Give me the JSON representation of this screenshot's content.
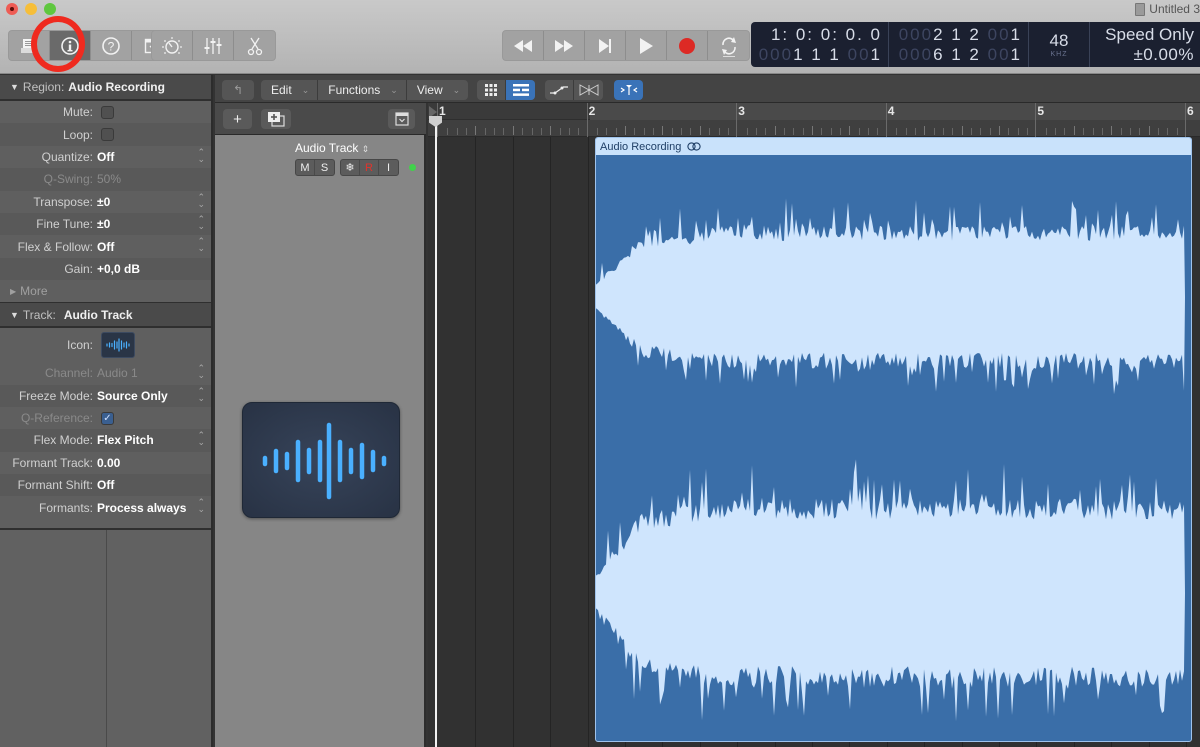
{
  "window": {
    "title": "Untitled 3",
    "traffic_lights": [
      "close",
      "minimize",
      "zoom"
    ]
  },
  "control_bar": {
    "view_buttons": [
      {
        "name": "library-button",
        "icon": "library-icon",
        "glyph": "▤"
      },
      {
        "name": "inspector-button",
        "icon": "info-icon",
        "glyph": "ⓘ",
        "active": true,
        "highlighted": true
      },
      {
        "name": "quick-help-button",
        "icon": "help-icon",
        "glyph": "?"
      },
      {
        "name": "toolbar-button",
        "icon": "toolbar-icon",
        "glyph": "⌄"
      }
    ],
    "edit_buttons": [
      {
        "name": "smart-controls-button",
        "icon": "knob-icon",
        "glyph": "☼"
      },
      {
        "name": "mixer-button",
        "icon": "mixer-icon",
        "glyph": "⫶"
      },
      {
        "name": "editors-button",
        "icon": "scissors-icon",
        "glyph": "✂"
      }
    ],
    "transport": [
      {
        "name": "rewind-button",
        "icon": "rewind-icon",
        "glyph": "◀◀"
      },
      {
        "name": "fast-forward-button",
        "icon": "fast-forward-icon",
        "glyph": "▶▶"
      },
      {
        "name": "go-to-end-button",
        "icon": "skip-end-icon",
        "glyph": "▶|"
      },
      {
        "name": "play-button",
        "icon": "play-icon",
        "glyph": "▶"
      },
      {
        "name": "record-button",
        "icon": "record-icon",
        "glyph": "●"
      },
      {
        "name": "cycle-button",
        "icon": "cycle-icon",
        "glyph": "⟳"
      }
    ],
    "lcd": {
      "smpte": "1:  0:  0:  0.  0",
      "position_dim": "000",
      "position": "1  1  1",
      "position_sub_dim": "00",
      "position_sub": "1",
      "locator_left_dim": "000",
      "locator_left": "2  1  2",
      "locator_left_sub_dim": "00",
      "locator_left_sub": "1",
      "locator_right_dim": "000",
      "locator_right": "6  1  2",
      "locator_right_sub_dim": "00",
      "locator_right_sub": "1",
      "sample_rate": "48",
      "sample_rate_unit": "KHZ",
      "varispeed_mode": "Speed Only",
      "varispeed_value": "±0.00%"
    }
  },
  "inspector": {
    "region": {
      "header_label": "Region:",
      "header_value": "Audio Recording",
      "rows": [
        {
          "label": "Mute:",
          "type": "checkbox",
          "checked": false
        },
        {
          "label": "Loop:",
          "type": "checkbox",
          "checked": false
        },
        {
          "label": "Quantize:",
          "value": "Off",
          "stepper": true
        },
        {
          "label": "Q-Swing:",
          "value": "50%",
          "disabled": true
        },
        {
          "label": "Transpose:",
          "value": "±0",
          "stepper": true
        },
        {
          "label": "Fine Tune:",
          "value": "±0",
          "stepper": true
        },
        {
          "label": "Flex & Follow:",
          "value": "Off",
          "stepper": true
        },
        {
          "label": "Gain:",
          "value": "+0,0 dB"
        }
      ],
      "more_label": "More"
    },
    "track": {
      "header_label": "Track:",
      "header_value": "Audio Track",
      "icon_label": "Icon:",
      "rows": [
        {
          "label": "Channel:",
          "value": "Audio 1",
          "stepper": true,
          "disabled": true
        },
        {
          "label": "Freeze Mode:",
          "value": "Source Only",
          "stepper": true
        },
        {
          "label": "Q-Reference:",
          "type": "checkbox",
          "checked": true,
          "disabled": true
        },
        {
          "label": "Flex Mode:",
          "value": "Flex Pitch",
          "stepper": true
        },
        {
          "label": "Formant Track:",
          "value": "0.00"
        },
        {
          "label": "Formant Shift:",
          "value": "Off"
        },
        {
          "label": "Formants:",
          "value": "Process always",
          "stepper": true
        }
      ]
    }
  },
  "tracks_toolbar": {
    "back_glyph": "↰",
    "menus": [
      {
        "label": "Edit"
      },
      {
        "label": "Functions"
      },
      {
        "label": "View"
      }
    ],
    "chevron": "⌄"
  },
  "track_header": {
    "add_glyph": "+",
    "name": "Audio Track",
    "name_stepper": "⌃⌄",
    "buttons": [
      {
        "label": "M",
        "name": "mute-button"
      },
      {
        "label": "S",
        "name": "solo-button"
      }
    ],
    "buttons2": [
      {
        "label": "❄",
        "name": "freeze-button"
      },
      {
        "label": "R",
        "name": "record-enable-button"
      },
      {
        "label": "I",
        "name": "input-monitor-button"
      }
    ]
  },
  "ruler": {
    "bars": [
      "1",
      "2",
      "3",
      "4",
      "5",
      "6"
    ]
  },
  "region": {
    "name": "Audio Recording",
    "stereo_glyph": "Ⓞ",
    "color": "#3a6ea8",
    "waveform_color": "#cfe5fd"
  },
  "colors": {
    "record": "#dd2a25",
    "highlight_ring": "#ef2a1f",
    "accent_blue": "#3a73b8",
    "input_led": "#40d24b"
  }
}
